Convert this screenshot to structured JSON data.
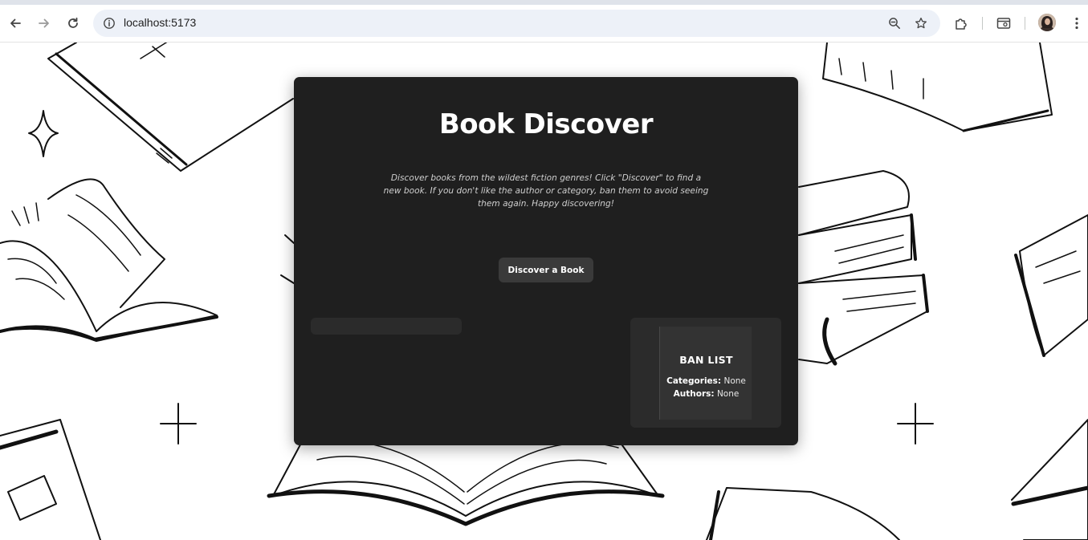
{
  "browser": {
    "url": "localhost:5173",
    "icons": [
      "back-icon",
      "forward-icon",
      "reload-icon",
      "site-info-icon",
      "zoom-icon",
      "bookmark-star-icon",
      "extensions-icon",
      "tab-search-icon",
      "profile-avatar",
      "more-menu-icon"
    ]
  },
  "page": {
    "title": "Book Discover",
    "description": "Discover books from the wildest fiction genres! Click \"Discover\" to find a new book. If you don't like the author or category, ban them to avoid seeing them again. Happy discovering!",
    "discover_button": "Discover a Book",
    "ban_list": {
      "title": "BAN LIST",
      "categories_label": "Categories:",
      "categories_value": "None",
      "authors_label": "Authors:",
      "authors_value": "None"
    }
  },
  "colors": {
    "card_bg": "#1f1f1f",
    "panel_bg": "#2b2b2b",
    "button_bg": "#3a3a3a",
    "text": "#ffffff"
  }
}
